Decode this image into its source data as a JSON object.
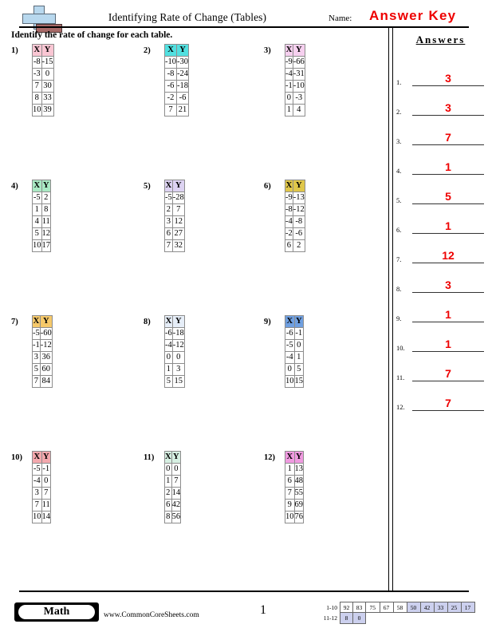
{
  "header": {
    "title": "Identifying Rate of Change (Tables)",
    "name_label": "Name:",
    "answer_key_stamp": "Answer Key",
    "logo_name": "commoncoresheets-logo"
  },
  "instruction": "Identify the rate of change for each table.",
  "answers_panel": {
    "title": "Answers",
    "items": [
      {
        "number": "1.",
        "value": "3"
      },
      {
        "number": "2.",
        "value": "3"
      },
      {
        "number": "3.",
        "value": "7"
      },
      {
        "number": "4.",
        "value": "1"
      },
      {
        "number": "5.",
        "value": "5"
      },
      {
        "number": "6.",
        "value": "1"
      },
      {
        "number": "7.",
        "value": "12"
      },
      {
        "number": "8.",
        "value": "3"
      },
      {
        "number": "9.",
        "value": "1"
      },
      {
        "number": "10.",
        "value": "1"
      },
      {
        "number": "11.",
        "value": "7"
      },
      {
        "number": "12.",
        "value": "7"
      }
    ],
    "answer_color": "#ee0000"
  },
  "columns": {
    "x": "X",
    "y": "Y"
  },
  "problems": [
    {
      "number": "1)",
      "header_color": "#f9c6d3",
      "rows": [
        [
          "-8",
          "-15"
        ],
        [
          "-3",
          "0"
        ],
        [
          "7",
          "30"
        ],
        [
          "8",
          "33"
        ],
        [
          "10",
          "39"
        ]
      ]
    },
    {
      "number": "2)",
      "header_color": "#52e0e0",
      "rows": [
        [
          "-10",
          "-30"
        ],
        [
          "-8",
          "-24"
        ],
        [
          "-6",
          "-18"
        ],
        [
          "-2",
          "-6"
        ],
        [
          "7",
          "21"
        ]
      ]
    },
    {
      "number": "3)",
      "header_color": "#f6d0ef",
      "rows": [
        [
          "-9",
          "-66"
        ],
        [
          "-4",
          "-31"
        ],
        [
          "-1",
          "-10"
        ],
        [
          "0",
          "-3"
        ],
        [
          "1",
          "4"
        ]
      ]
    },
    {
      "number": "4)",
      "header_color": "#a9e9c3",
      "rows": [
        [
          "-5",
          "2"
        ],
        [
          "1",
          "8"
        ],
        [
          "4",
          "11"
        ],
        [
          "5",
          "12"
        ],
        [
          "10",
          "17"
        ]
      ]
    },
    {
      "number": "5)",
      "header_color": "#ddd3f2",
      "rows": [
        [
          "-5",
          "-28"
        ],
        [
          "2",
          "7"
        ],
        [
          "3",
          "12"
        ],
        [
          "6",
          "27"
        ],
        [
          "7",
          "32"
        ]
      ]
    },
    {
      "number": "6)",
      "header_color": "#e0c74a",
      "rows": [
        [
          "-9",
          "-13"
        ],
        [
          "-8",
          "-12"
        ],
        [
          "-4",
          "-8"
        ],
        [
          "-2",
          "-6"
        ],
        [
          "6",
          "2"
        ]
      ]
    },
    {
      "number": "7)",
      "header_color": "#f6c96a",
      "rows": [
        [
          "-5",
          "-60"
        ],
        [
          "-1",
          "-12"
        ],
        [
          "3",
          "36"
        ],
        [
          "5",
          "60"
        ],
        [
          "7",
          "84"
        ]
      ]
    },
    {
      "number": "8)",
      "header_color": "#e6eef8",
      "rows": [
        [
          "-6",
          "-18"
        ],
        [
          "-4",
          "-12"
        ],
        [
          "0",
          "0"
        ],
        [
          "1",
          "3"
        ],
        [
          "5",
          "15"
        ]
      ]
    },
    {
      "number": "9)",
      "header_color": "#6f9fe0",
      "rows": [
        [
          "-6",
          "-1"
        ],
        [
          "-5",
          "0"
        ],
        [
          "-4",
          "1"
        ],
        [
          "0",
          "5"
        ],
        [
          "10",
          "15"
        ]
      ]
    },
    {
      "number": "10)",
      "header_color": "#f4a8ad",
      "rows": [
        [
          "-5",
          "-1"
        ],
        [
          "-4",
          "0"
        ],
        [
          "3",
          "7"
        ],
        [
          "7",
          "11"
        ],
        [
          "10",
          "14"
        ]
      ]
    },
    {
      "number": "11)",
      "header_color": "#d6f0e2",
      "rows": [
        [
          "0",
          "0"
        ],
        [
          "1",
          "7"
        ],
        [
          "2",
          "14"
        ],
        [
          "6",
          "42"
        ],
        [
          "8",
          "56"
        ]
      ]
    },
    {
      "number": "12)",
      "header_color": "#f09ae0",
      "rows": [
        [
          "1",
          "13"
        ],
        [
          "6",
          "48"
        ],
        [
          "7",
          "55"
        ],
        [
          "9",
          "69"
        ],
        [
          "10",
          "76"
        ]
      ]
    }
  ],
  "footer": {
    "subject_label": "Math",
    "site_url": "www.CommonCoreSheets.com",
    "page_number": "1",
    "score_grid": {
      "rows": [
        {
          "label": "1-10",
          "cells": [
            {
              "value": "92",
              "highlight": false
            },
            {
              "value": "83",
              "highlight": false
            },
            {
              "value": "75",
              "highlight": false
            },
            {
              "value": "67",
              "highlight": false
            },
            {
              "value": "58",
              "highlight": false
            },
            {
              "value": "50",
              "highlight": true
            },
            {
              "value": "42",
              "highlight": true
            },
            {
              "value": "33",
              "highlight": true
            },
            {
              "value": "25",
              "highlight": true
            },
            {
              "value": "17",
              "highlight": true
            }
          ]
        },
        {
          "label": "11-12",
          "cells": [
            {
              "value": "8",
              "highlight": true
            },
            {
              "value": "0",
              "highlight": true
            }
          ]
        }
      ]
    }
  }
}
